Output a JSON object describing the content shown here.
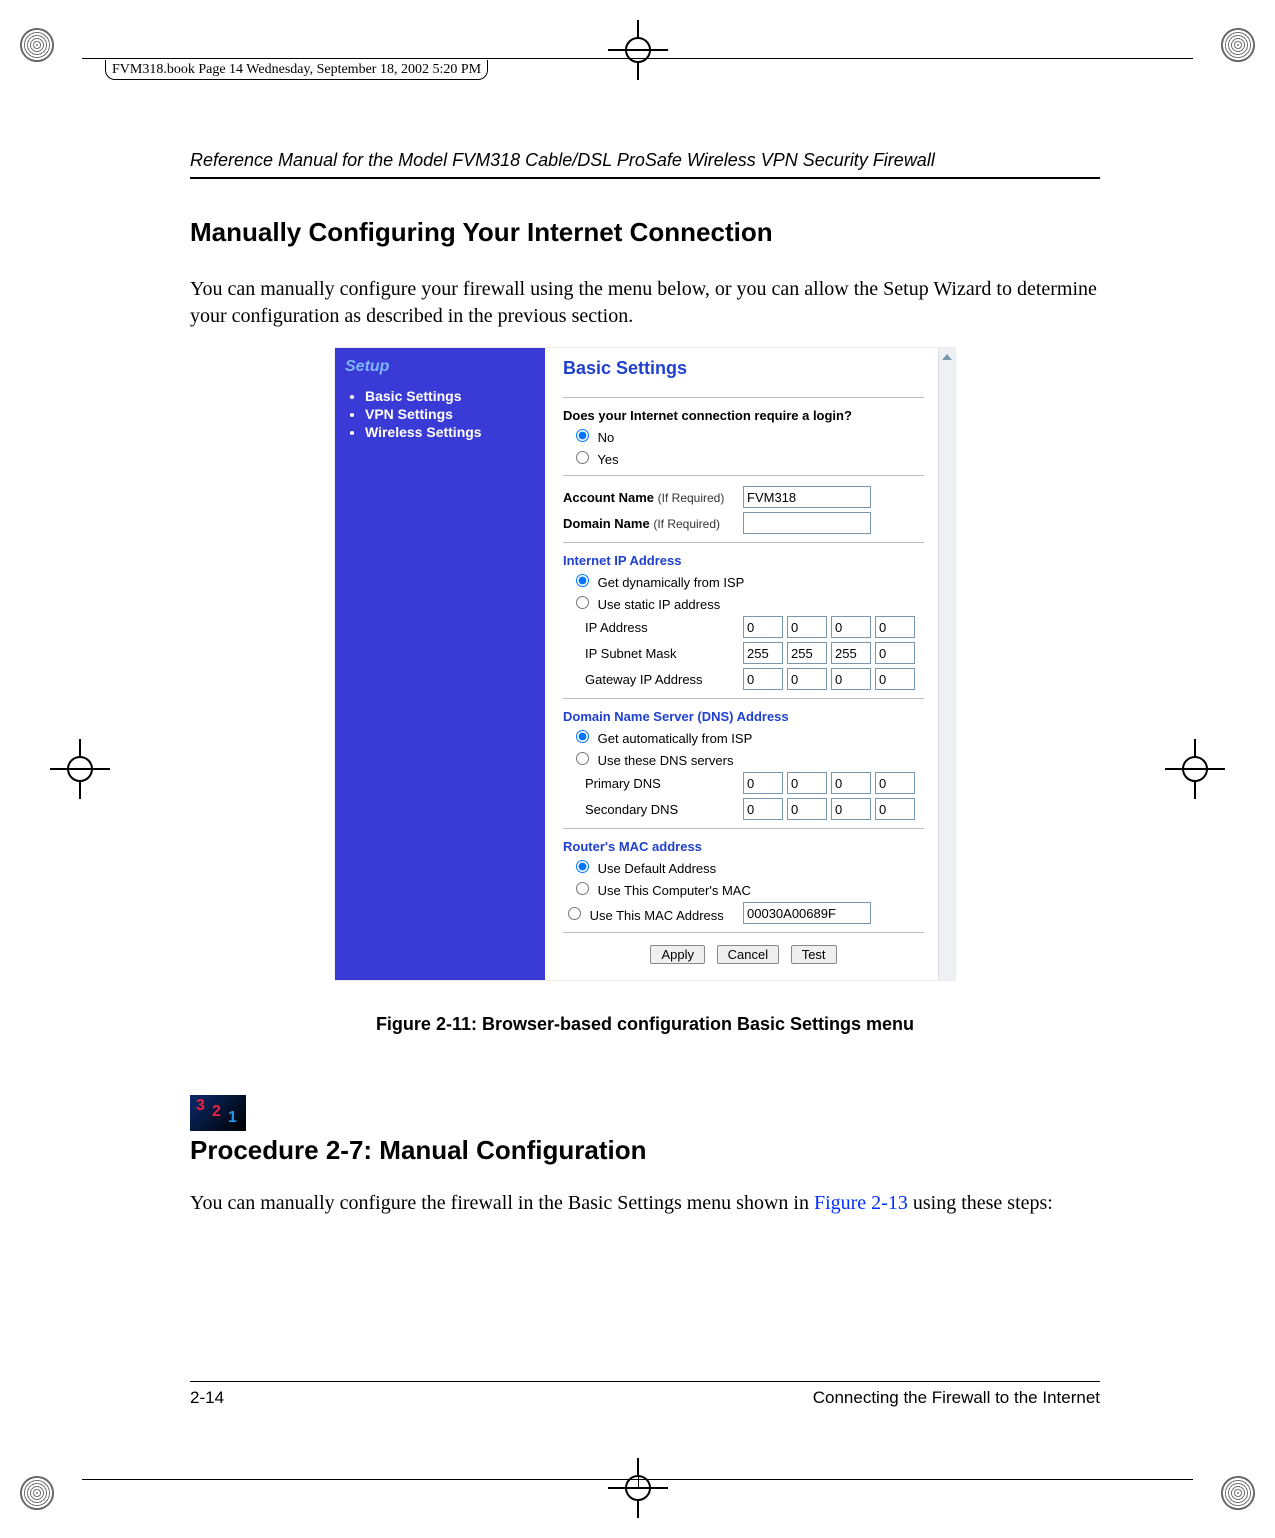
{
  "print_meta": "FVM318.book  Page 14  Wednesday, September 18, 2002  5:20 PM",
  "running_head": "Reference Manual for the Model FVM318 Cable/DSL ProSafe Wireless VPN Security Firewall",
  "section_title": "Manually Configuring Your Internet Connection",
  "intro_para": "You can manually configure your firewall using the menu below, or you can allow the Setup Wizard to determine your configuration as described in the previous section.",
  "figure_caption": "Figure 2-11: Browser-based configuration Basic Settings menu",
  "procedure_title": "Procedure 2-7:  Manual Configuration",
  "procedure_intro_a": "You can manually configure the firewall in the Basic Settings menu shown in ",
  "procedure_xref": "Figure 2-13",
  "procedure_intro_b": " using these steps:",
  "footer_left": "2-14",
  "footer_right": "Connecting the Firewall to the Internet",
  "ui": {
    "sidebar": {
      "heading": "Setup",
      "items": [
        "Basic Settings",
        "VPN Settings",
        "Wireless Settings"
      ]
    },
    "page_title": "Basic Settings",
    "login_q": "Does your Internet connection require a login?",
    "login_no": "No",
    "login_yes": "Yes",
    "account_name_label": "Account Name",
    "account_name_note": "(If Required)",
    "account_name_value": "FVM318",
    "domain_name_label": "Domain Name",
    "domain_name_note": "(If Required)",
    "domain_name_value": "",
    "ip_section": "Internet IP Address",
    "ip_dyn": "Get dynamically from ISP",
    "ip_static": "Use static IP address",
    "ip_addr_label": "IP Address",
    "ip_addr": [
      "0",
      "0",
      "0",
      "0"
    ],
    "ip_mask_label": "IP Subnet Mask",
    "ip_mask": [
      "255",
      "255",
      "255",
      "0"
    ],
    "ip_gw_label": "Gateway IP Address",
    "ip_gw": [
      "0",
      "0",
      "0",
      "0"
    ],
    "dns_section": "Domain Name Server (DNS) Address",
    "dns_auto": "Get automatically from ISP",
    "dns_manual": "Use these DNS servers",
    "dns_primary_label": "Primary DNS",
    "dns_primary": [
      "0",
      "0",
      "0",
      "0"
    ],
    "dns_secondary_label": "Secondary DNS",
    "dns_secondary": [
      "0",
      "0",
      "0",
      "0"
    ],
    "mac_section": "Router's MAC address",
    "mac_default": "Use Default Address",
    "mac_this_pc": "Use This Computer's MAC",
    "mac_custom": "Use This MAC Address",
    "mac_custom_value": "00030A00689F",
    "btn_apply": "Apply",
    "btn_cancel": "Cancel",
    "btn_test": "Test"
  }
}
